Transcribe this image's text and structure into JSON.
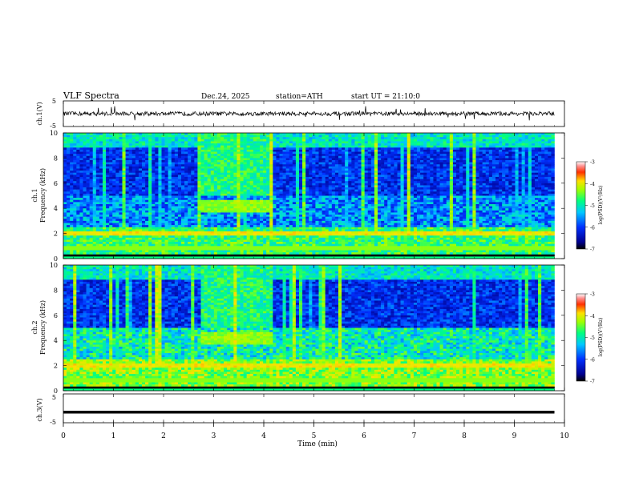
{
  "header": {
    "title": "VLF  Spectra",
    "date": "Dec.24, 2025",
    "station": "station=ATH",
    "start": "start  UT  =    21:10:0"
  },
  "chart_data": [
    {
      "type": "line",
      "panel": "ch1",
      "ylabel": "ch.1(V)",
      "yticks": [
        "5",
        "-5"
      ],
      "ylim": [
        -5,
        5
      ],
      "xlim": [
        0,
        10
      ],
      "description_series": "broadband waveform, near 0 V with small fluctuations",
      "mean_value": 0.0
    },
    {
      "type": "heatmap",
      "panel": "ch1-spectrogram",
      "ylabel": "ch.1\nFrequency  (kHz)",
      "yticks": [
        "0",
        "2",
        "4",
        "6",
        "8",
        "10"
      ],
      "ylim": [
        0,
        10
      ],
      "xlim": [
        0,
        10
      ],
      "colorbar": {
        "label": "log(PSD)(V²/Hz)",
        "ticks": [
          "-3",
          "-4",
          "-5",
          "-6",
          "-7"
        ],
        "range": [
          -7,
          -3
        ]
      }
    },
    {
      "type": "heatmap",
      "panel": "ch2-spectrogram",
      "ylabel": "ch.2\nFrequency  (kHz)",
      "yticks": [
        "0",
        "2",
        "4",
        "6",
        "8",
        "10"
      ],
      "ylim": [
        0,
        10
      ],
      "xlim": [
        0,
        10
      ],
      "colorbar": {
        "label": "log(PSD)(V²/Hz)",
        "ticks": [
          "-3",
          "-4",
          "-5",
          "-6",
          "-7"
        ],
        "range": [
          -7,
          -3
        ]
      }
    },
    {
      "type": "line",
      "panel": "ch3",
      "ylabel": "ch.3(V)",
      "yticks": [
        "5",
        "-5"
      ],
      "ylim": [
        -5,
        5
      ],
      "xlim": [
        0,
        10
      ],
      "mean_value": -1.5
    }
  ],
  "xaxis": {
    "label": "Time  (min)",
    "ticks": [
      "0",
      "1",
      "2",
      "3",
      "4",
      "5",
      "6",
      "7",
      "8",
      "9",
      "10"
    ]
  }
}
